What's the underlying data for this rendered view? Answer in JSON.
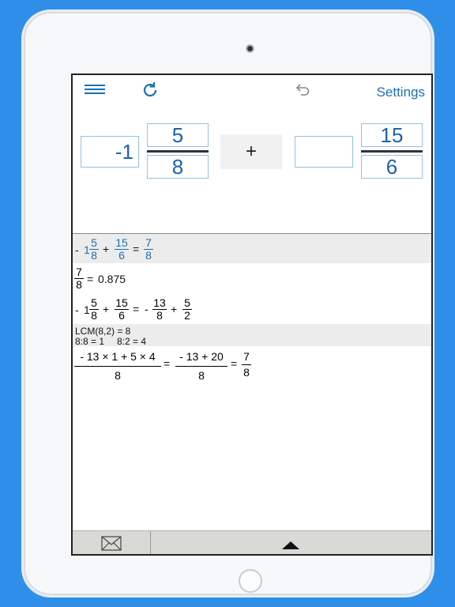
{
  "toolbar": {
    "menu_icon": "hamburger-menu-icon",
    "refresh_icon": "refresh-icon",
    "undo_icon": "undo-icon",
    "settings_label": "Settings"
  },
  "input": {
    "first": {
      "whole": "-1",
      "numerator": "5",
      "denominator": "8"
    },
    "operator": "+",
    "second": {
      "whole": "",
      "numerator": "15",
      "denominator": "6"
    }
  },
  "results": {
    "row1": {
      "sign": "-",
      "whole": "1",
      "a_num": "5",
      "a_den": "8",
      "plus": "+",
      "b_num": "15",
      "b_den": "6",
      "eq": "=",
      "r_num": "7",
      "r_den": "8"
    },
    "row2": {
      "num": "7",
      "den": "8",
      "eq": "=",
      "decimal": "0.875"
    },
    "row3": {
      "sign": "-",
      "whole": "1",
      "a_num": "5",
      "a_den": "8",
      "plus": "+",
      "b_num": "15",
      "b_den": "6",
      "eq": "=",
      "c_sign": "-",
      "c_num": "13",
      "c_den": "8",
      "plus2": "+",
      "d_num": "5",
      "d_den": "2"
    },
    "row4": {
      "lcm": "LCM(8,2) = 8",
      "div1": "8:8 = 1",
      "div2": "8:2 = 4"
    },
    "row5": {
      "num1": "- 13 × 1 + 5 × 4",
      "den1": "8",
      "eq1": "=",
      "num2": "- 13 + 20",
      "den2": "8",
      "eq2": "=",
      "num3": "7",
      "den3": "8"
    }
  },
  "bottom_bar": {
    "mail_icon": "envelope-icon",
    "expand_icon": "triangle-up-icon"
  },
  "colors": {
    "accent": "#1d6fb5",
    "background": "#2f8fe8"
  }
}
